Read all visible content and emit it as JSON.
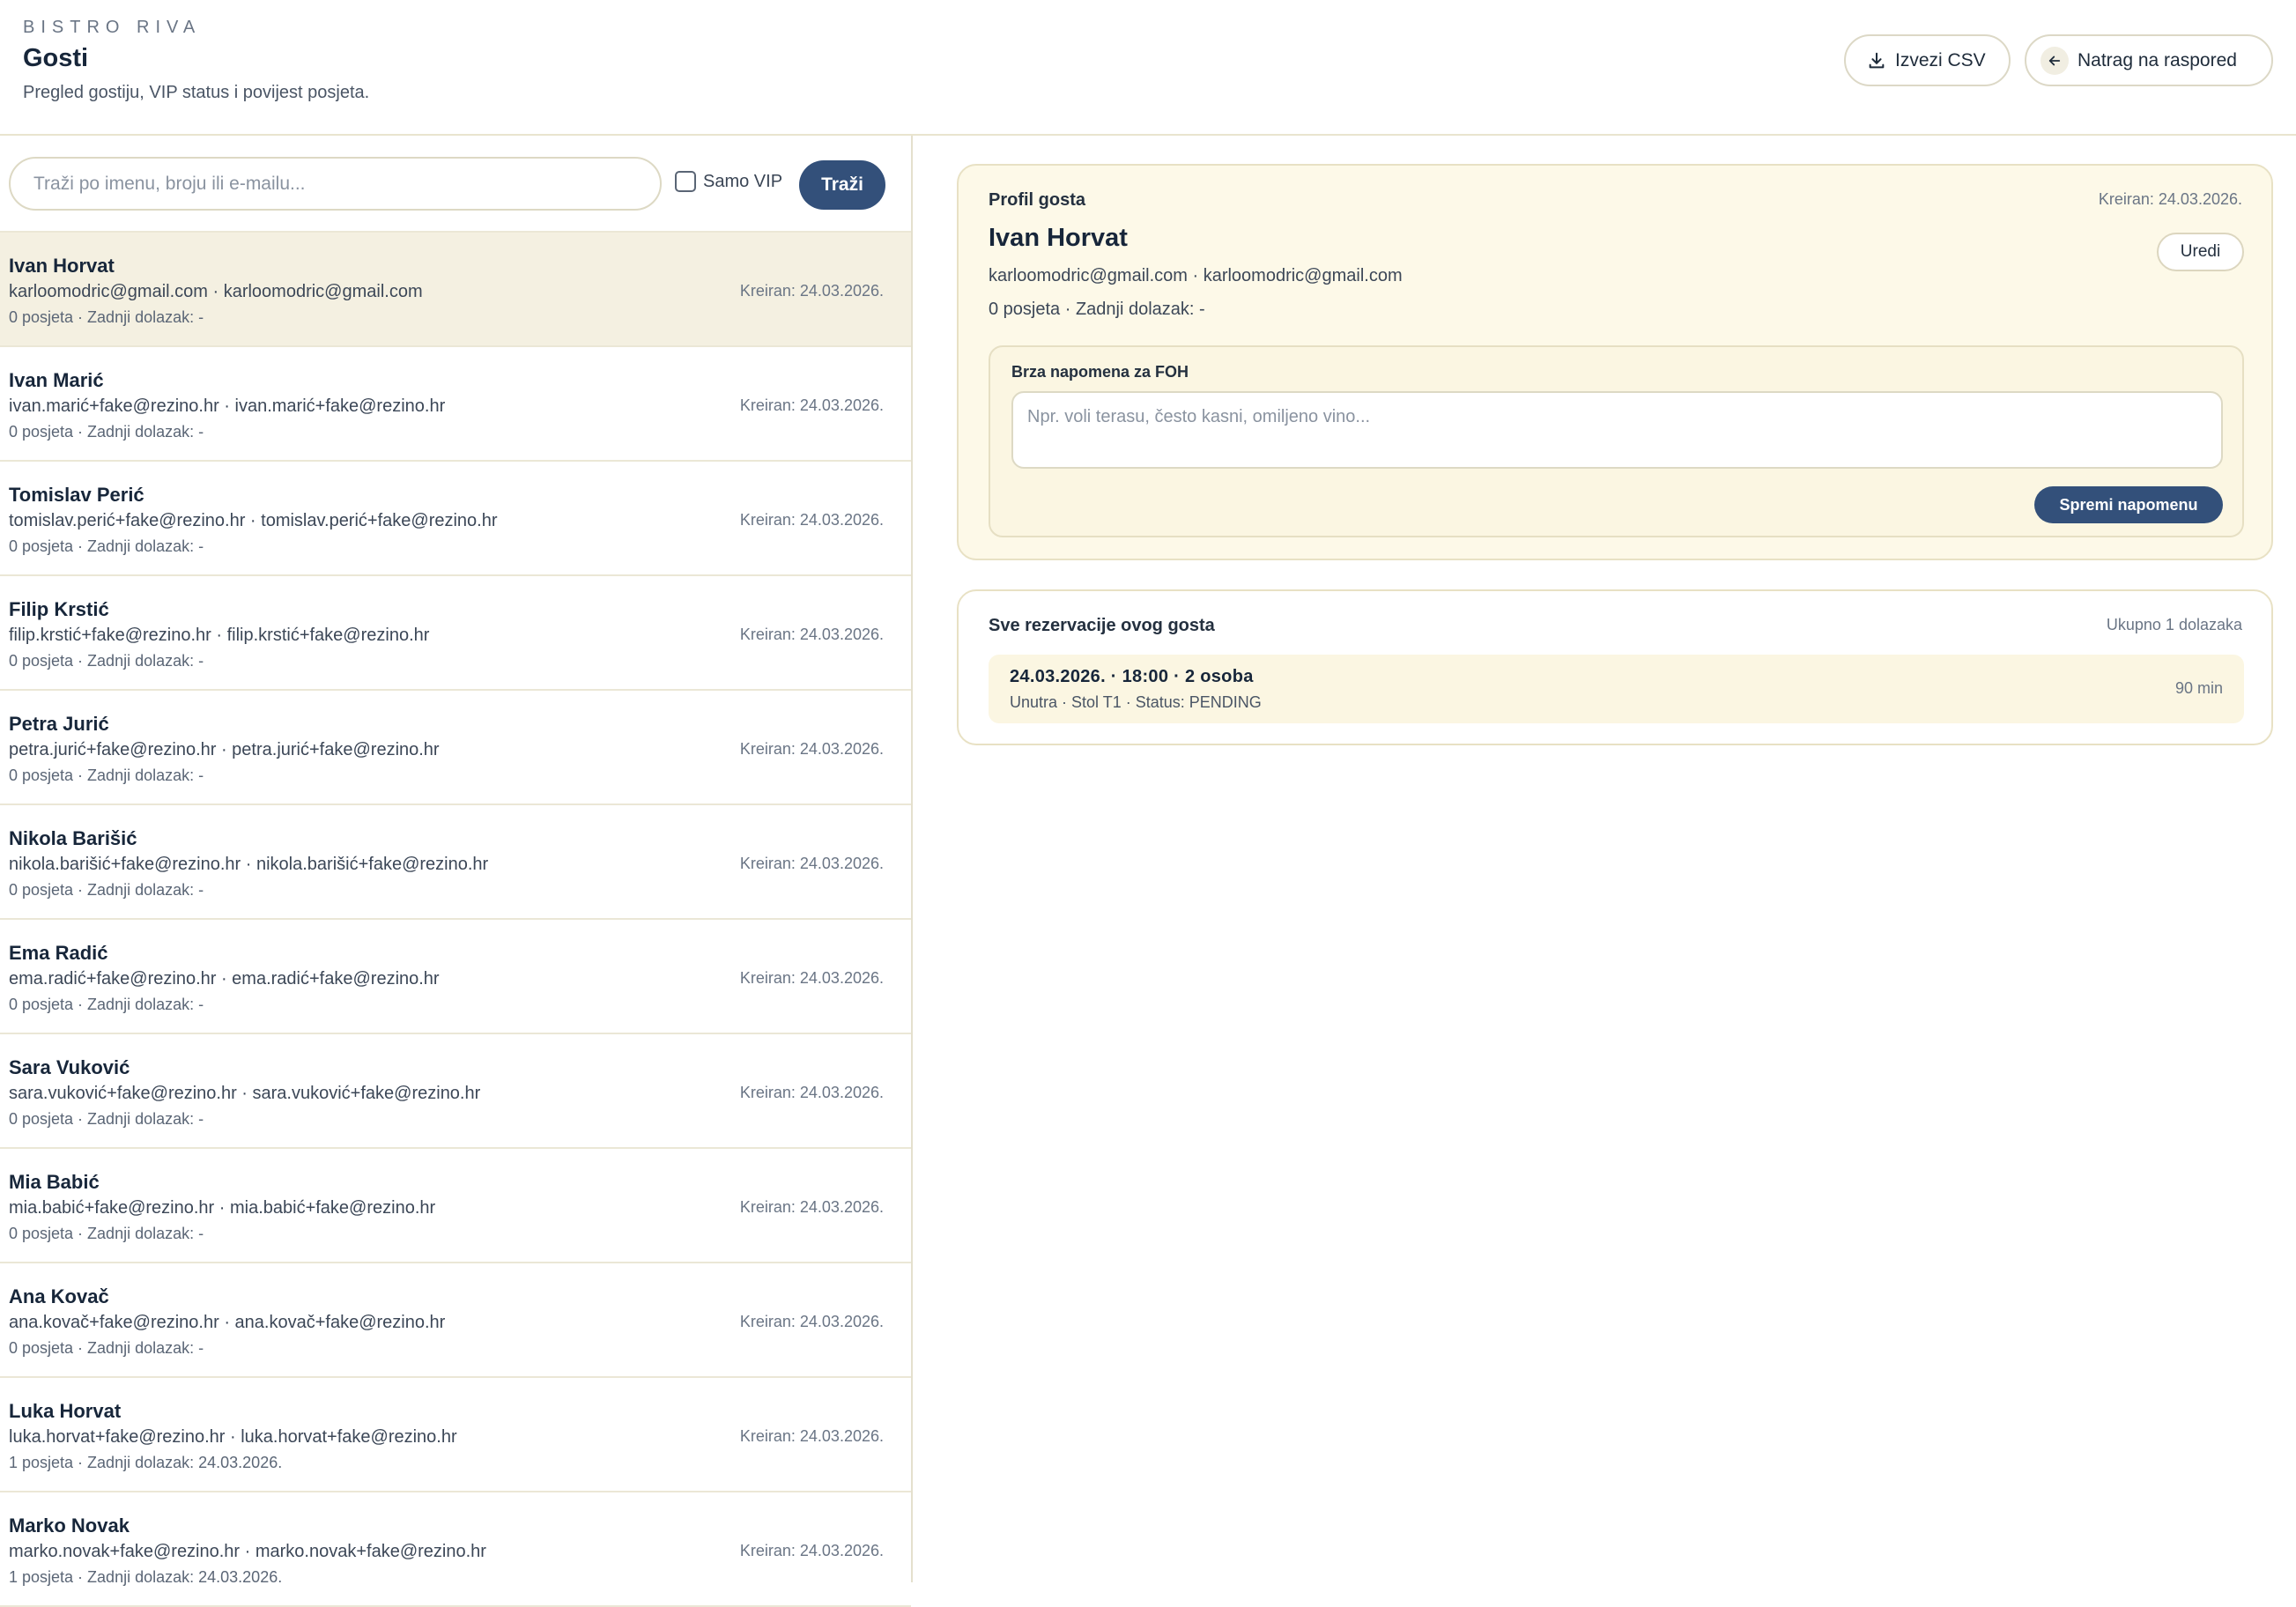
{
  "header": {
    "brand": "BISTRO RIVA",
    "title": "Gosti",
    "subtitle": "Pregled gostiju, VIP status i povijest posjeta.",
    "export_label": "Izvezi CSV",
    "back_label": "Natrag na raspored"
  },
  "search": {
    "placeholder": "Traži po imenu, broju ili e-mailu...",
    "vip_label": "Samo VIP",
    "vip_checked": false,
    "button_label": "Traži"
  },
  "guests": [
    {
      "name": "Ivan Horvat",
      "contact": "karloomodric@gmail.com · karloomodric@gmail.com",
      "meta": "0 posjeta · Zadnji dolazak: -",
      "created": "Kreiran: 24.03.2026."
    },
    {
      "name": "Ivan Marić",
      "contact": "ivan.marić+fake@rezino.hr · ivan.marić+fake@rezino.hr",
      "meta": "0 posjeta · Zadnji dolazak: -",
      "created": "Kreiran: 24.03.2026."
    },
    {
      "name": "Tomislav Perić",
      "contact": "tomislav.perić+fake@rezino.hr · tomislav.perić+fake@rezino.hr",
      "meta": "0 posjeta · Zadnji dolazak: -",
      "created": "Kreiran: 24.03.2026."
    },
    {
      "name": "Filip Krstić",
      "contact": "filip.krstić+fake@rezino.hr · filip.krstić+fake@rezino.hr",
      "meta": "0 posjeta · Zadnji dolazak: -",
      "created": "Kreiran: 24.03.2026."
    },
    {
      "name": "Petra Jurić",
      "contact": "petra.jurić+fake@rezino.hr · petra.jurić+fake@rezino.hr",
      "meta": "0 posjeta · Zadnji dolazak: -",
      "created": "Kreiran: 24.03.2026."
    },
    {
      "name": "Nikola Barišić",
      "contact": "nikola.barišić+fake@rezino.hr · nikola.barišić+fake@rezino.hr",
      "meta": "0 posjeta · Zadnji dolazak: -",
      "created": "Kreiran: 24.03.2026."
    },
    {
      "name": "Ema Radić",
      "contact": "ema.radić+fake@rezino.hr · ema.radić+fake@rezino.hr",
      "meta": "0 posjeta · Zadnji dolazak: -",
      "created": "Kreiran: 24.03.2026."
    },
    {
      "name": "Sara Vuković",
      "contact": "sara.vuković+fake@rezino.hr · sara.vuković+fake@rezino.hr",
      "meta": "0 posjeta · Zadnji dolazak: -",
      "created": "Kreiran: 24.03.2026."
    },
    {
      "name": "Mia Babić",
      "contact": "mia.babić+fake@rezino.hr · mia.babić+fake@rezino.hr",
      "meta": "0 posjeta · Zadnji dolazak: -",
      "created": "Kreiran: 24.03.2026."
    },
    {
      "name": "Ana Kovač",
      "contact": "ana.kovač+fake@rezino.hr · ana.kovač+fake@rezino.hr",
      "meta": "0 posjeta · Zadnji dolazak: -",
      "created": "Kreiran: 24.03.2026."
    },
    {
      "name": "Luka Horvat",
      "contact": "luka.horvat+fake@rezino.hr · luka.horvat+fake@rezino.hr",
      "meta": "1 posjeta · Zadnji dolazak: 24.03.2026.",
      "created": "Kreiran: 24.03.2026."
    },
    {
      "name": "Marko Novak",
      "contact": "marko.novak+fake@rezino.hr · marko.novak+fake@rezino.hr",
      "meta": "1 posjeta · Zadnji dolazak: 24.03.2026.",
      "created": "Kreiran: 24.03.2026."
    }
  ],
  "selected_guest_index": 0,
  "profile": {
    "section_label": "Profil gosta",
    "created": "Kreiran: 24.03.2026.",
    "name": "Ivan Horvat",
    "edit_label": "Uredi",
    "contact": "karloomodric@gmail.com · karloomodric@gmail.com",
    "meta": "0 posjeta · Zadnji dolazak: -",
    "note_label": "Brza napomena za FOH",
    "note_placeholder": "Npr. voli terasu, često kasni, omiljeno vino...",
    "note_value": "",
    "save_note_label": "Spremi napomenu"
  },
  "reservations": {
    "section_label": "Sve rezervacije ovog gosta",
    "count_label": "Ukupno 1 dolazaka",
    "items": [
      {
        "title": "24.03.2026. · 18:00 · 2 osoba",
        "detail": "Unutra · Stol T1 · Status: PENDING",
        "duration": "90 min"
      }
    ]
  },
  "icons": {
    "export": "download-icon",
    "back": "arrow-left-icon"
  },
  "colors": {
    "accent": "#33507a",
    "selected_row": "#f4f0e1",
    "card_background": "#fdf9e8"
  }
}
